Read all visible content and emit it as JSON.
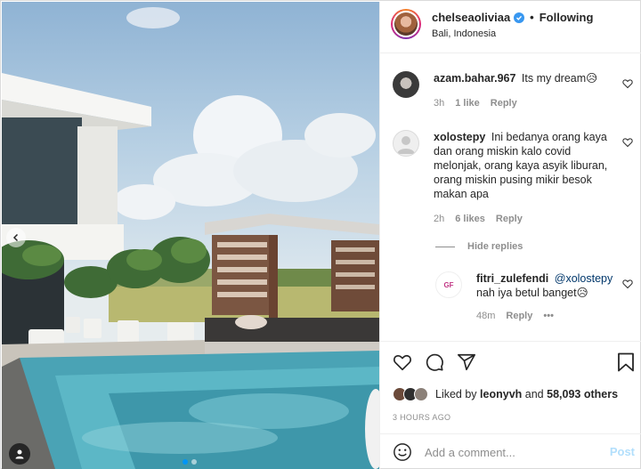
{
  "post": {
    "username": "chelseaoliviaa",
    "follow_label": "Following",
    "location": "Bali, Indonesia",
    "separator": "•"
  },
  "comments": [
    {
      "username": "azam.bahar.967",
      "text": "Its my dream😥",
      "time": "3h",
      "likes": "1 like",
      "reply_label": "Reply"
    },
    {
      "username": "xolostepy",
      "text": "Ini bedanya orang kaya dan orang miskin kalo covid melonjak, orang kaya asyik liburan, orang miskin pusing mikir besok makan apa",
      "time": "2h",
      "likes": "6 likes",
      "reply_label": "Reply"
    }
  ],
  "hide_replies_label": "Hide replies",
  "reply": {
    "username": "fitri_zulefendi",
    "mention": "@xolostepy",
    "text": "nah iya betul banget😥",
    "time": "48m",
    "reply_label": "Reply",
    "more": "•••",
    "avatar_initials": "GF"
  },
  "likes": {
    "prefix": "Liked by",
    "user": "leonyvh",
    "joiner": "and",
    "others": "58,093 others"
  },
  "time_ago": "3 HOURS AGO",
  "add_comment": {
    "placeholder": "Add a comment...",
    "post_label": "Post"
  },
  "carousel": {
    "slide_count": 2,
    "active_index": 0
  },
  "colors": {
    "accent": "#0095f6",
    "verified": "#3897f0",
    "post_disabled": "#b2dffc",
    "muted": "#8e8e8e"
  }
}
